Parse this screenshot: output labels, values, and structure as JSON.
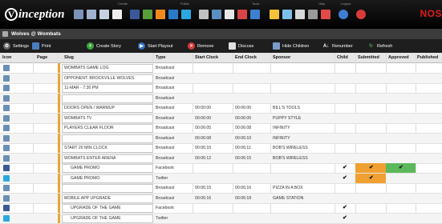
{
  "app": {
    "logo_text": "inception",
    "brand_right": "NOS"
  },
  "top_group_labels": [
    "Create",
    "Public",
    "Tools",
    "Help",
    "Logout"
  ],
  "panel": {
    "title": "Wolves @ Wombats"
  },
  "toolbar": {
    "settings": "Settings",
    "print": "Print",
    "create_story": "Create Story",
    "start_playout": "Start Playout",
    "remove": "Remove",
    "discuss": "Discuss",
    "hide_children": "Hide Children",
    "renumber": "Renumber",
    "refresh": "Refresh"
  },
  "columns": {
    "icon": "Icon",
    "page": "Page",
    "slug": "Slug",
    "type": "Type",
    "start_clock": "Start Clock",
    "end_clock": "End Clock",
    "sponsor": "Sponsor",
    "child": "Child",
    "submitted": "Submitted",
    "approved": "Approved",
    "published": "Published"
  },
  "rows": [
    {
      "icon": "broadcast",
      "slug": "WOMBATS GAME LOG",
      "type": "Broadcast",
      "start": "",
      "end": "",
      "sponsor": "",
      "child": "",
      "submitted": "",
      "approved": ""
    },
    {
      "icon": "broadcast",
      "slug": "OPPONENT: BROCKVILLE WOLVES",
      "type": "Broadcast",
      "start": "",
      "end": "",
      "sponsor": "",
      "child": "",
      "submitted": "",
      "approved": ""
    },
    {
      "icon": "broadcast",
      "slug": "11-MAR - 7:30 PM",
      "type": "Broadcast",
      "start": "",
      "end": "",
      "sponsor": "",
      "child": "",
      "submitted": "",
      "approved": ""
    },
    {
      "icon": "broadcast",
      "slug": "",
      "type": "Broadcast",
      "start": "",
      "end": "",
      "sponsor": "",
      "child": "",
      "submitted": "",
      "approved": ""
    },
    {
      "icon": "broadcast",
      "slug": "DOORS OPEN / WARMUP",
      "type": "Broadcast",
      "start": "00:00:00",
      "end": "00:06:00",
      "sponsor": "BILL'S TOOLS",
      "child": "",
      "submitted": "",
      "approved": ""
    },
    {
      "icon": "broadcast",
      "slug": "WOMBATS TV",
      "type": "Broadcast",
      "start": "00:06:00",
      "end": "00:06:05",
      "sponsor": "PUPPY STYLE",
      "child": "",
      "submitted": "",
      "approved": ""
    },
    {
      "icon": "broadcast",
      "slug": "PLAYERS CLEAR FLOOR",
      "type": "Broadcast",
      "start": "00:06:05",
      "end": "00:06:08",
      "sponsor": "INFINITY",
      "child": "",
      "submitted": "",
      "approved": ""
    },
    {
      "icon": "broadcast",
      "slug": "",
      "type": "Broadcast",
      "start": "00:06:08",
      "end": "00:06:10",
      "sponsor": "INFINITY",
      "child": "",
      "submitted": "",
      "approved": ""
    },
    {
      "icon": "broadcast",
      "slug": "START 20 MIN CLOCK",
      "type": "Broadcast",
      "start": "00:06:10",
      "end": "00:06:11",
      "sponsor": "BOB'S WIRELESS",
      "child": "",
      "submitted": "",
      "approved": ""
    },
    {
      "icon": "broadcast",
      "slug": "WOMBATS ENTER ARENA",
      "type": "Broadcast",
      "start": "00:06:12",
      "end": "00:06:15",
      "sponsor": "BOB'S WIRELESS",
      "child": "",
      "submitted": "",
      "approved": ""
    },
    {
      "icon": "facebook",
      "slug": "GAME PROMO",
      "type": "Facebook",
      "start": "",
      "end": "",
      "sponsor": "",
      "child": "✔",
      "submitted": "✔",
      "approved": "✔",
      "indent": true
    },
    {
      "icon": "twitter",
      "slug": "GAME PROMO",
      "type": "Twitter",
      "start": "",
      "end": "",
      "sponsor": "",
      "child": "✔",
      "submitted": "✔",
      "approved": "",
      "indent": true
    },
    {
      "icon": "broadcast",
      "slug": "",
      "type": "Broadcast",
      "start": "00:06:15",
      "end": "00:06:16",
      "sponsor": "PIZZA IN A BOX",
      "child": "",
      "submitted": "",
      "approved": ""
    },
    {
      "icon": "broadcast",
      "slug": "MOBILE APP UPGRADE",
      "type": "Broadcast",
      "start": "00:06:16",
      "end": "00:06:18",
      "sponsor": "GAME STATION",
      "child": "",
      "submitted": "",
      "approved": ""
    },
    {
      "icon": "facebook",
      "slug": "UPGRADE OF THE GAME",
      "type": "Facebook",
      "start": "",
      "end": "",
      "sponsor": "",
      "child": "✔",
      "submitted": "",
      "approved": "",
      "indent": true
    },
    {
      "icon": "twitter",
      "slug": "UPGRADE OF THE GAME",
      "type": "Twitter",
      "start": "",
      "end": "",
      "sponsor": "",
      "child": "✔",
      "submitted": "",
      "approved": "",
      "indent": true
    }
  ],
  "colors": {
    "broadcast_icon": "#6a8fb5",
    "facebook_icon": "#3b5998",
    "twitter_icon": "#2aa9e0",
    "slug_bar": "#e8a53a",
    "submitted_fill": "#f0a030",
    "approved_fill": "#5cb85c"
  }
}
